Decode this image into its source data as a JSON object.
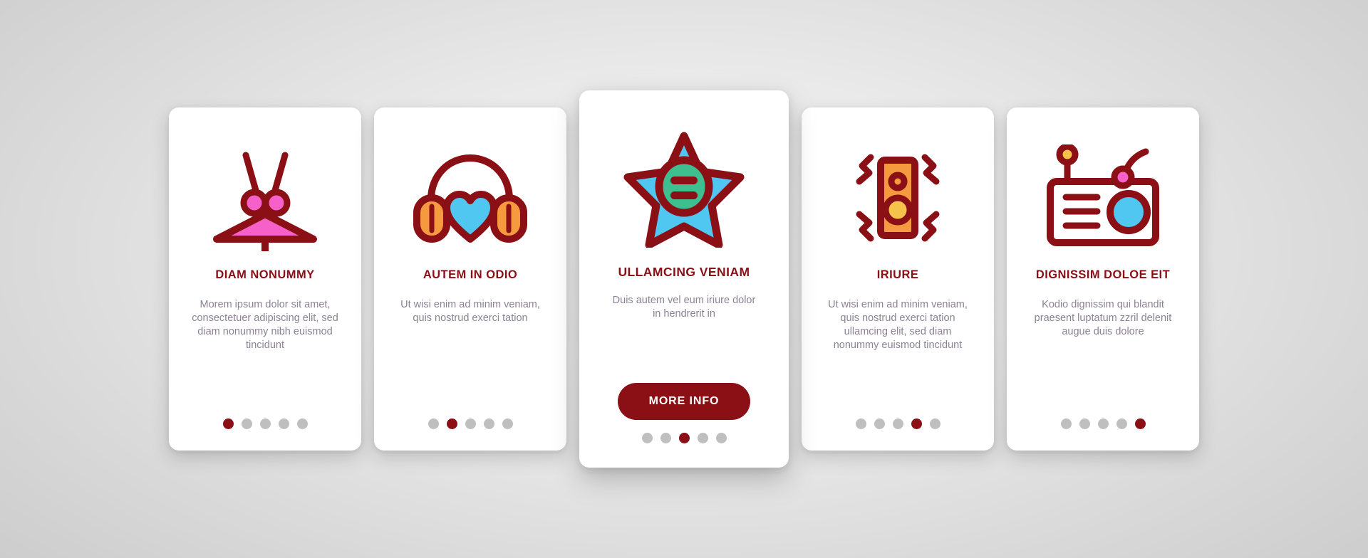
{
  "palette": {
    "brand_red": "#8B1016",
    "body_text": "#8d8293",
    "dot_inactive": "#bfbfbf",
    "card_bg": "#ffffff",
    "accent_pink": "#F561C8",
    "accent_cyan": "#4FC7F0",
    "accent_orange": "#F59A3E",
    "accent_green": "#3FBF8F",
    "accent_yellow": "#F5C24A"
  },
  "cards": [
    {
      "id": "card-diam-nonummy",
      "icon": "drum-sticks-icon",
      "title": "DIAM NONUMMY",
      "body": "Morem ipsum dolor sit amet, consectetuer adipiscing elit, sed diam nonummy nibh euismod tincidunt",
      "featured": false,
      "dots": {
        "count": 5,
        "active_index": 0
      }
    },
    {
      "id": "card-autem-in-odio",
      "icon": "headphones-heart-icon",
      "title": "AUTEM IN ODIO",
      "body": "Ut wisi enim ad minim veniam, quis nostrud exerci tation",
      "featured": false,
      "dots": {
        "count": 5,
        "active_index": 1
      }
    },
    {
      "id": "card-ullamcing-veniam",
      "icon": "star-equalizer-icon",
      "title": "ULLAMCING VENIAM",
      "body": "Duis autem vel eum iriure dolor in hendrerit in",
      "featured": true,
      "cta_label": "MORE INFO",
      "dots": {
        "count": 5,
        "active_index": 2
      }
    },
    {
      "id": "card-iriure",
      "icon": "speaker-soundwaves-icon",
      "title": "IRIURE",
      "body": "Ut wisi enim ad minim veniam, quis nostrud exerci tation ullamcing elit, sed diam nonummy euismod tincidunt",
      "featured": false,
      "dots": {
        "count": 5,
        "active_index": 3
      }
    },
    {
      "id": "card-dignissim-doloe-eit",
      "icon": "radio-receiver-icon",
      "title": "DIGNISSIM DOLOE EIT",
      "body": "Kodio dignissim qui blandit praesent luptatum zzril delenit augue duis dolore",
      "featured": false,
      "dots": {
        "count": 5,
        "active_index": 4
      }
    }
  ]
}
